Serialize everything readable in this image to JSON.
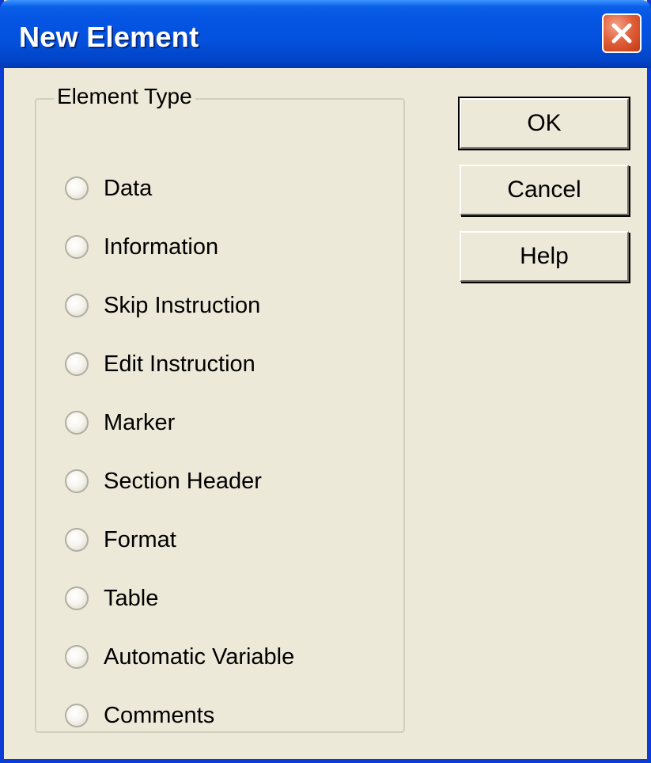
{
  "window": {
    "title": "New Element"
  },
  "element_type_group": {
    "label": "Element Type",
    "options": [
      "Data",
      "Information",
      "Skip Instruction",
      "Edit Instruction",
      "Marker",
      "Section Header",
      "Format",
      "Table",
      "Automatic Variable",
      "Comments"
    ]
  },
  "buttons": {
    "ok": "OK",
    "cancel": "Cancel",
    "help": "Help"
  },
  "colors": {
    "titlebar": "#0554e3",
    "close_button": "#e2613b",
    "dialog_face": "#ece9d8"
  },
  "icons": {
    "close": "close-x-icon"
  }
}
